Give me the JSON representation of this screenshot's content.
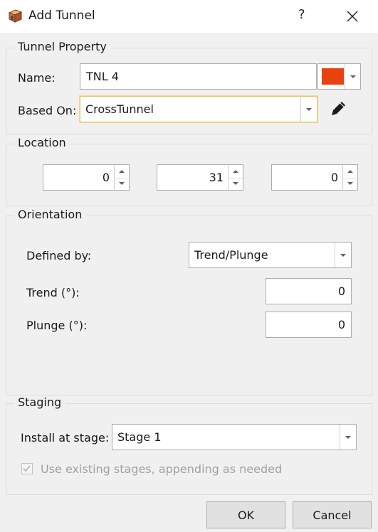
{
  "window": {
    "title": "Add Tunnel",
    "help": "?"
  },
  "tunnel_property": {
    "legend": "Tunnel Property",
    "name_label": "Name:",
    "name_value": "TNL 4",
    "color": "#e8430e",
    "based_on_label": "Based On:",
    "based_on_value": "CrossTunnel"
  },
  "location": {
    "legend": "Location",
    "x": "0",
    "y": "31",
    "z": "0"
  },
  "orientation": {
    "legend": "Orientation",
    "defined_by_label": "Defined by:",
    "defined_by_value": "Trend/Plunge",
    "trend_label": "Trend (°):",
    "trend_value": "0",
    "plunge_label": "Plunge (°):",
    "plunge_value": "0"
  },
  "staging": {
    "legend": "Staging",
    "install_label": "Install at stage:",
    "install_value": "Stage 1",
    "use_existing_label": "Use existing stages, appending as needed",
    "use_existing_checked": true
  },
  "buttons": {
    "ok": "OK",
    "cancel": "Cancel"
  }
}
